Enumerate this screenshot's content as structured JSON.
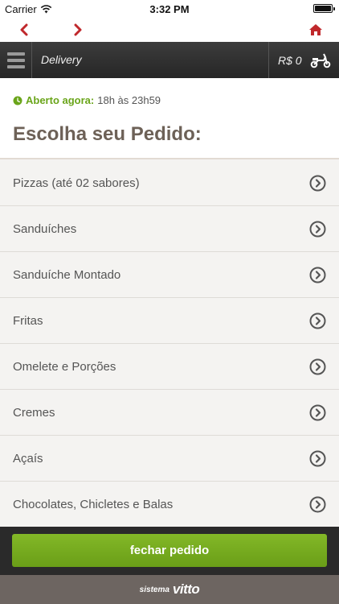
{
  "status_bar": {
    "carrier": "Carrier",
    "time": "3:32 PM"
  },
  "nav": {
    "back_icon": "chevron-left-icon",
    "forward_icon": "chevron-right-icon",
    "home_icon": "home-icon",
    "accent_color": "#c0282c"
  },
  "header": {
    "title": "Delivery",
    "cart_value": "R$ 0",
    "cart_icon": "scooter-icon"
  },
  "store": {
    "open_label": "Aberto agora:",
    "hours": "18h às 23h59",
    "open_color": "#6aa51a"
  },
  "page": {
    "title": "Escolha seu Pedido:"
  },
  "menu_items": [
    {
      "label": "Pizzas (até 02 sabores)"
    },
    {
      "label": "Sanduíches"
    },
    {
      "label": "Sanduíche Montado"
    },
    {
      "label": "Fritas"
    },
    {
      "label": "Omelete e Porções"
    },
    {
      "label": "Cremes"
    },
    {
      "label": "Açaís"
    },
    {
      "label": "Chocolates, Chicletes e Balas"
    }
  ],
  "footer": {
    "close_button": "fechar pedido",
    "button_color": "#7ab022"
  },
  "brand": {
    "prefix": "sistema",
    "name": "vitto"
  }
}
